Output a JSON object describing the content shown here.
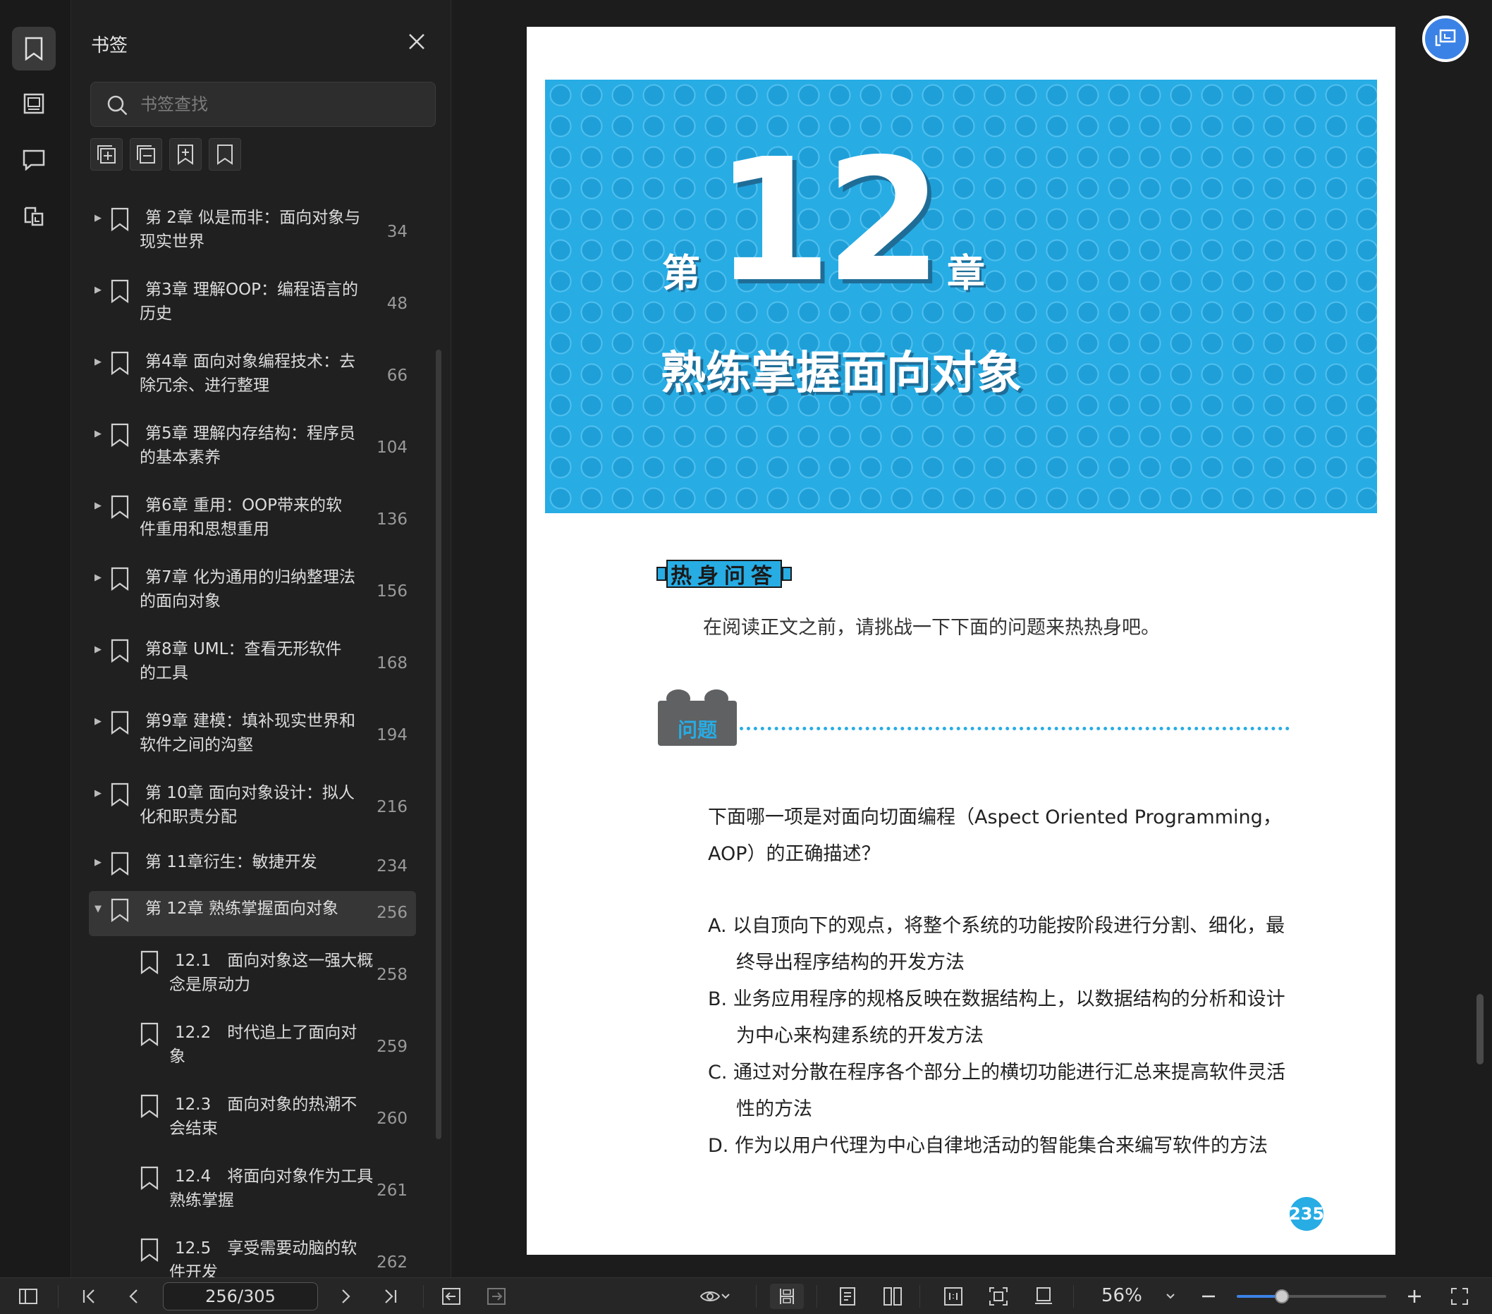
{
  "sidebar_panel": {
    "title": "书签",
    "search_placeholder": "书签查找",
    "bookmarks": [
      {
        "line1": "第 2章 似是而非：面向对象与",
        "line2": "现实世界",
        "page": "34",
        "level": 0,
        "expanded": false,
        "selected": false
      },
      {
        "line1": "第3章 理解OOP：编程语言的",
        "line2": "历史",
        "page": "48",
        "level": 0,
        "expanded": false,
        "selected": false
      },
      {
        "line1": "第4章 面向对象编程技术：去",
        "line2": "除冗余、进行整理",
        "page": "66",
        "level": 0,
        "expanded": false,
        "selected": false
      },
      {
        "line1": "第5章 理解内存结构：程序员",
        "line2": "的基本素养",
        "page": "104",
        "level": 0,
        "expanded": false,
        "selected": false
      },
      {
        "line1": "第6章 重用：OOP带来的软",
        "line2": "件重用和思想重用",
        "page": "136",
        "level": 0,
        "expanded": false,
        "selected": false
      },
      {
        "line1": "第7章 化为通用的归纳整理法",
        "line2": "的面向对象",
        "page": "156",
        "level": 0,
        "expanded": false,
        "selected": false
      },
      {
        "line1": "第8章 UML：查看无形软件",
        "line2": "的工具",
        "page": "168",
        "level": 0,
        "expanded": false,
        "selected": false
      },
      {
        "line1": "第9章 建模：填补现实世界和",
        "line2": "软件之间的沟壑",
        "page": "194",
        "level": 0,
        "expanded": false,
        "selected": false
      },
      {
        "line1": "第 10章 面向对象设计：拟人",
        "line2": "化和职责分配",
        "page": "216",
        "level": 0,
        "expanded": false,
        "selected": false
      },
      {
        "line1": "第 11章衍生：敏捷开发",
        "line2": "",
        "page": "234",
        "level": 0,
        "expanded": false,
        "selected": false
      },
      {
        "line1": "第 12章 熟练掌握面向对象",
        "line2": "",
        "page": "256",
        "level": 0,
        "expanded": true,
        "selected": true
      },
      {
        "line1": "12.1　面向对象这一强大概",
        "line2": "念是原动力",
        "page": "258",
        "level": 1,
        "expanded": false,
        "selected": false
      },
      {
        "line1": "12.2　时代追上了面向对",
        "line2": "象",
        "page": "259",
        "level": 1,
        "expanded": false,
        "selected": false
      },
      {
        "line1": "12.3　面向对象的热潮不",
        "line2": "会结束",
        "page": "260",
        "level": 1,
        "expanded": false,
        "selected": false
      },
      {
        "line1": "12.4　将面向对象作为工具",
        "line2": "熟练掌握",
        "page": "261",
        "level": 1,
        "expanded": false,
        "selected": false
      },
      {
        "line1": "12.5　享受需要动脑的软",
        "line2": "件开发",
        "page": "262",
        "level": 1,
        "expanded": false,
        "selected": false
      }
    ]
  },
  "document": {
    "chapter_prefix": "第",
    "chapter_number": "12",
    "chapter_suffix": "章",
    "chapter_title": "熟练掌握面向对象",
    "warmup_tag": "热身问答",
    "warmup_intro": "在阅读正文之前，请挑战一下下面的问题来热热身吧。",
    "question_tag": "问题",
    "question": "下面哪一项是对面向切面编程（Aspect Oriented Programming，AOP）的正确描述？",
    "options": [
      "A. 以自顶向下的观点，将整个系统的功能按阶段进行分割、细化，最终导出程序结构的开发方法",
      "B. 业务应用程序的规格反映在数据结构上，以数据结构的分析和设计为中心来构建系统的开发方法",
      "C. 通过对分散在程序各个部分上的横切功能进行汇总来提高软件灵活性的方法",
      "D. 作为以用户代理为中心自律地活动的智能集合来编写软件的方法"
    ],
    "page_number": "235"
  },
  "bottombar": {
    "page_indicator": "256/305",
    "zoom": "56%",
    "zoom_fraction": 0.3
  },
  "colors": {
    "accent_blue": "#27ace4",
    "app_bg": "#1e1e1e",
    "selection": "#363636"
  }
}
